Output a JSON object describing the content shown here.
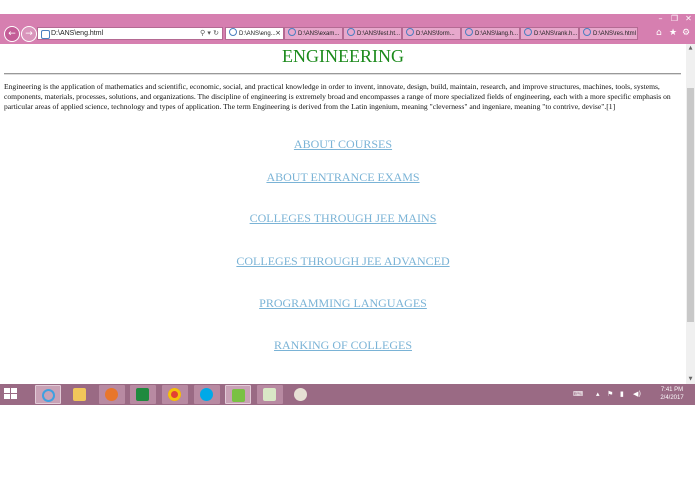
{
  "browser": {
    "address": "D:\\ANS\\eng.html",
    "address_tools": "⚲ ▾ ↻",
    "tabs": [
      {
        "label": "D:\\ANS\\eng...",
        "close": "×"
      },
      {
        "label": "D:\\ANS\\exam..."
      },
      {
        "label": "D:\\ANS\\fest.ht..."
      },
      {
        "label": "D:\\ANS\\form..."
      },
      {
        "label": "D:\\ANS\\lang.h..."
      },
      {
        "label": "D:\\ANS\\rank.h..."
      },
      {
        "label": "D:\\ANS\\res.html"
      }
    ],
    "window_controls": {
      "minimize": "–",
      "restore": "❐",
      "close": "✕"
    },
    "right_buttons": {
      "home": "⌂",
      "favorites": "★",
      "settings": "⚙"
    },
    "nav": {
      "back": "←",
      "forward": "→"
    }
  },
  "page": {
    "title": "ENGINEERING",
    "intro": "Engineering is the application of mathematics and scientific, economic, social, and practical knowledge in order to invent, innovate, design, build, maintain, research, and improve structures, machines, tools, systems, components, materials, processes, solutions, and organizations. The discipline of engineering is extremely broad and encompasses a range of more specialized fields of engineering, each with a more specific emphasis on particular areas of applied science, technology and types of application. The term Engineering is derived from the Latin ingenium, meaning \"cleverness\" and ingeniare, meaning \"to contrive, devise\".[1]",
    "links": [
      "ABOUT COURSES",
      "ABOUT ENTRANCE EXAMS",
      "COLLEGES THROUGH JEE MAINS",
      "COLLEGES THROUGH JEE ADVANCED",
      "PROGRAMMING LANGUAGES",
      "RANKING OF COLLEGES"
    ]
  },
  "scrollbar": {
    "up": "▲",
    "down": "▼"
  },
  "taskbar": {
    "tray": {
      "keyboard": "⌨",
      "caret": "▴",
      "flag": "⚑",
      "signal": "▮",
      "volume": "◀)"
    },
    "time": "7:41 PM",
    "date": "2/4/2017"
  },
  "colors": {
    "chrome": "#d67fb0",
    "link": "#7ab3d6",
    "title": "#1b8a1b",
    "taskbar": "#9a6a84"
  }
}
